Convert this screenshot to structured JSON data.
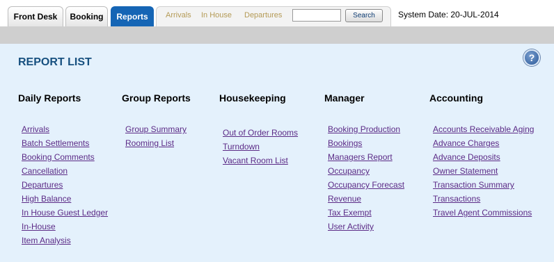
{
  "tabs": [
    {
      "label": "Front Desk",
      "active": false
    },
    {
      "label": "Booking",
      "active": false
    },
    {
      "label": "Reports",
      "active": true
    }
  ],
  "subnav": {
    "links": [
      "Arrivals",
      "In House",
      "Departures"
    ],
    "search_value": "",
    "search_button": "Search"
  },
  "system_date": "System Date: 20-JUL-2014",
  "title": "REPORT LIST",
  "help_icon": "?",
  "columns": [
    {
      "heading": "Daily Reports",
      "items": [
        "Arrivals",
        "Batch Settlements",
        "Booking Comments",
        "Cancellation",
        "Departures",
        "High Balance",
        "In House Guest Ledger",
        "In-House",
        "Item Analysis"
      ]
    },
    {
      "heading": "Group Reports",
      "items": [
        "Group Summary",
        "Rooming List"
      ]
    },
    {
      "heading": "Housekeeping",
      "items": [
        "Out of Order Rooms",
        "Turndown",
        "Vacant Room List"
      ]
    },
    {
      "heading": "Manager",
      "items": [
        "Booking Production",
        "Bookings",
        "Managers Report",
        "Occupancy",
        "Occupancy Forecast",
        "Revenue",
        "Tax Exempt",
        "User Activity"
      ]
    },
    {
      "heading": "Accounting",
      "items": [
        "Accounts Receivable Aging",
        "Advance Charges",
        "Advance Deposits",
        "Owner Statement",
        "Transaction Summary",
        "Transactions",
        "Travel Agent Commissions"
      ]
    }
  ],
  "colors": {
    "active_tab": "#1565b5",
    "link": "#5b2a86",
    "title": "#17507f",
    "panel_bg": "#e4f1fc"
  }
}
